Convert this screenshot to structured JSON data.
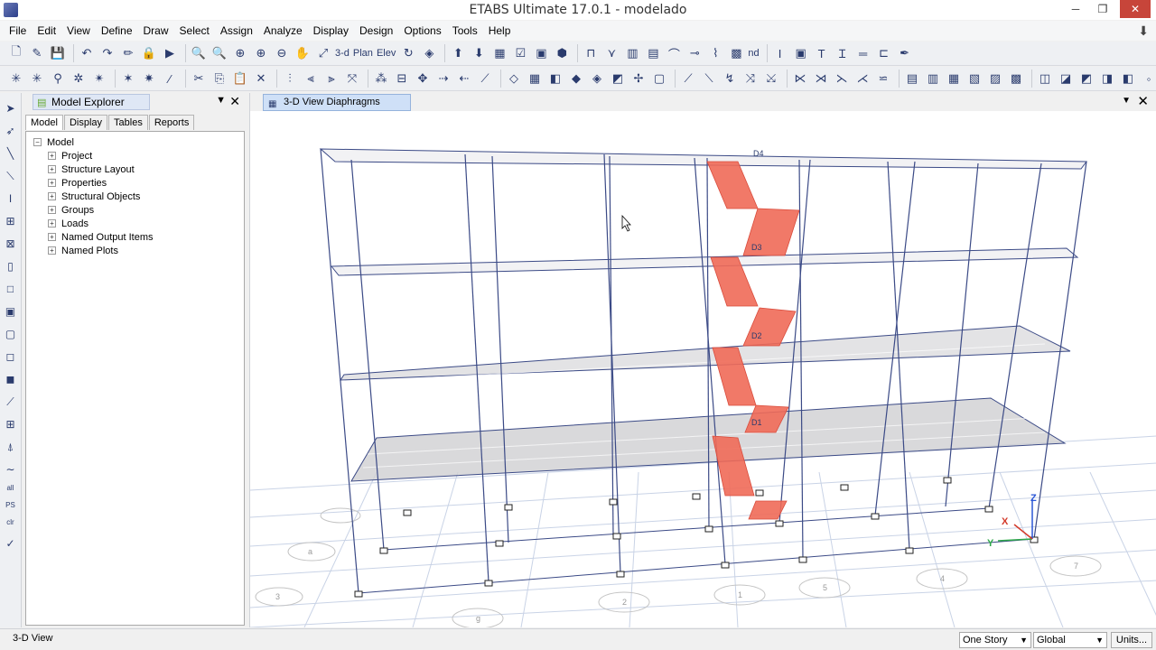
{
  "window": {
    "title": "ETABS Ultimate 17.0.1 - modelado",
    "minimize": "─",
    "restore": "❐",
    "close": "✕"
  },
  "menubar": {
    "items": [
      "File",
      "Edit",
      "View",
      "Define",
      "Draw",
      "Select",
      "Assign",
      "Analyze",
      "Display",
      "Design",
      "Options",
      "Tools",
      "Help"
    ]
  },
  "toolbar": {
    "label_3d": "3-d",
    "label_plan": "Plan",
    "label_elev": "Elev",
    "label_nd": "nd"
  },
  "left_toolbar": {
    "label_all": "all",
    "label_ps": "PS",
    "label_clr": "clr"
  },
  "explorer": {
    "title": "Model Explorer",
    "tabs": [
      "Model",
      "Display",
      "Tables",
      "Reports"
    ],
    "root": "Model",
    "nodes": [
      "Project",
      "Structure Layout",
      "Properties",
      "Structural Objects",
      "Groups",
      "Loads",
      "Named Output Items",
      "Named Plots"
    ]
  },
  "viewport": {
    "tab_title": "3-D View  Diaphragms",
    "diaphragm_labels": [
      "D4",
      "D3",
      "D2",
      "D1"
    ],
    "axis_labels": {
      "x": "X",
      "y": "Y",
      "z": "Z"
    },
    "grid_bubbles": [
      "g",
      "2",
      "1",
      "a",
      "5",
      "4",
      "3",
      "7"
    ]
  },
  "statusbar": {
    "text": "3-D View",
    "story_select": "One Story",
    "coord_select": "Global",
    "units_button": "Units..."
  },
  "colors": {
    "diaphragm_highlight": "#f06a58",
    "frame_lines": "#3b4a86",
    "grid_lines": "#c9d3e6"
  }
}
